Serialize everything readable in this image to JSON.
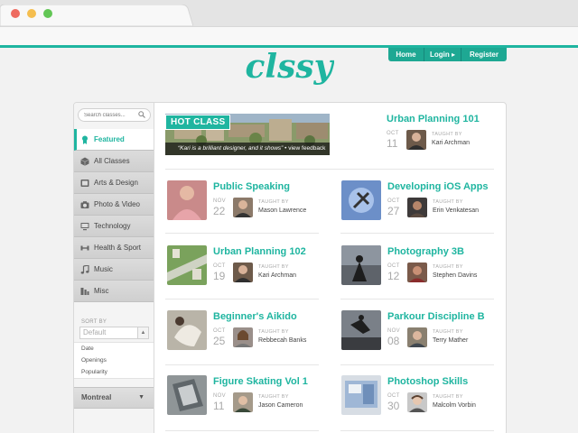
{
  "colors": {
    "accent": "#1fb5a0",
    "dot_red": "#ee6a5f",
    "dot_yellow": "#f5be4f",
    "dot_green": "#62c655"
  },
  "nav": {
    "home": "Home",
    "login": "Login ▸",
    "register": "Register"
  },
  "logo": "clssy",
  "search": {
    "placeholder": "Search classes..."
  },
  "sidebar": {
    "items": [
      {
        "label": "Featured",
        "icon": "ribbon-icon",
        "active": true
      },
      {
        "label": "All Classes",
        "icon": "cube-icon"
      },
      {
        "label": "Arts & Design",
        "icon": "palette-icon"
      },
      {
        "label": "Photo & Video",
        "icon": "camera-icon"
      },
      {
        "label": "Technology",
        "icon": "monitor-icon"
      },
      {
        "label": "Health & Sport",
        "icon": "dumbbell-icon"
      },
      {
        "label": "Music",
        "icon": "music-note-icon"
      },
      {
        "label": "Misc",
        "icon": "misc-icon"
      }
    ],
    "sort_label": "SORT BY",
    "sort_value": "Default",
    "sort_options": [
      "Date",
      "Openings",
      "Popularity"
    ],
    "city": "Montreal"
  },
  "hot_class": {
    "tag": "HOT CLASS",
    "quote": "“Kari is a brilliant designer, and it shows”",
    "link": "• view feedback"
  },
  "taught_by": "TAUGHT BY",
  "classes": [
    {
      "title": "Urban Planning 101",
      "month": "OCT",
      "day": "11",
      "teacher": "Kari Archman"
    },
    {
      "title": "Public Speaking",
      "month": "NOV",
      "day": "22",
      "teacher": "Mason Lawrence"
    },
    {
      "title": "Developing iOS Apps",
      "month": "OCT",
      "day": "27",
      "teacher": "Erin Venkatesan"
    },
    {
      "title": "Urban Planning 102",
      "month": "OCT",
      "day": "19",
      "teacher": "Kari Archman"
    },
    {
      "title": "Photography 3B",
      "month": "OCT",
      "day": "12",
      "teacher": "Stephen Davins"
    },
    {
      "title": "Beginner's Aikido",
      "month": "OCT",
      "day": "25",
      "teacher": "Rebbecah Banks"
    },
    {
      "title": "Parkour Discipline B",
      "month": "NOV",
      "day": "08",
      "teacher": "Terry Mather"
    },
    {
      "title": "Figure Skating Vol 1",
      "month": "NOV",
      "day": "11",
      "teacher": "Jason Cameron"
    },
    {
      "title": "Photoshop Skills",
      "month": "OCT",
      "day": "30",
      "teacher": "Malcolm Vorbin"
    }
  ]
}
